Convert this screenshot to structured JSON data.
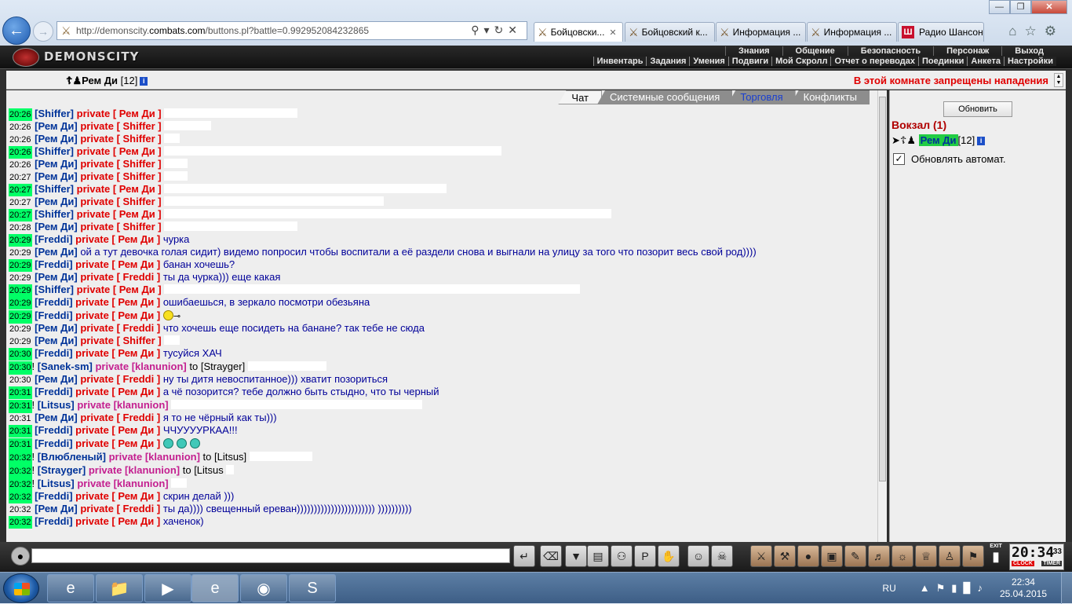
{
  "browser": {
    "url_prefix": "http://demonscity.",
    "url_domain": "combats.com",
    "url_path": "/buttons.pl?battle=0.992952084232865",
    "tabs": [
      {
        "label": "Бойцовски...",
        "active": true
      },
      {
        "label": "Бойцовский к..."
      },
      {
        "label": "Информация ..."
      },
      {
        "label": "Информация ..."
      },
      {
        "label": "Радио Шансон"
      }
    ]
  },
  "game": {
    "logo": "DEMONSCITY",
    "menu_top": [
      "Знания",
      "Общение",
      "Безопасность",
      "Персонаж",
      "Выход"
    ],
    "menu_sub": [
      "Инвентарь",
      "Задания",
      "Умения",
      "Подвиги",
      "Мой Скролл",
      "Отчет о переводах",
      "Поединки",
      "Анкета",
      "Настройки"
    ]
  },
  "room": {
    "user": "Рем Ди",
    "level": "[12]",
    "warning": "В этой комнате запрещены нападения"
  },
  "chat_tabs": [
    "Чат",
    "Системные сообщения",
    "Торговля",
    "Конфликты"
  ],
  "chat": [
    {
      "ts": "20:26",
      "hl": true,
      "nick": "[Shiffer]",
      "priv": "private [ Рем Ди ]",
      "msg": "",
      "redact": 170
    },
    {
      "ts": "20:26",
      "hl": false,
      "nick": "[Рем Ди]",
      "priv": "private [ Shiffer ]",
      "msg": "",
      "redact": 60
    },
    {
      "ts": "20:26",
      "hl": false,
      "nick": "[Рем Ди]",
      "priv": "private [ Shiffer ]",
      "msg": "",
      "redact": 20
    },
    {
      "ts": "20:26",
      "hl": true,
      "nick": "[Shiffer]",
      "priv": "private [ Рем Ди ]",
      "msg": "",
      "redact": 430
    },
    {
      "ts": "20:26",
      "hl": false,
      "nick": "[Рем Ди]",
      "priv": "private [ Shiffer ]",
      "msg": "",
      "redact": 30
    },
    {
      "ts": "20:27",
      "hl": false,
      "nick": "[Рем Ди]",
      "priv": "private [ Shiffer ]",
      "msg": "",
      "redact": 30
    },
    {
      "ts": "20:27",
      "hl": true,
      "nick": "[Shiffer]",
      "priv": "private [ Рем Ди ]",
      "msg": "",
      "redact": 360
    },
    {
      "ts": "20:27",
      "hl": false,
      "nick": "[Рем Ди]",
      "priv": "private [ Shiffer ]",
      "msg": "",
      "redact": 280
    },
    {
      "ts": "20:27",
      "hl": true,
      "nick": "[Shiffer]",
      "priv": "private [ Рем Ди ]",
      "msg": "",
      "redact": 570
    },
    {
      "ts": "20:28",
      "hl": false,
      "nick": "[Рем Ди]",
      "priv": "private [ Shiffer ]",
      "msg": "",
      "redact": 170
    },
    {
      "ts": "20:29",
      "hl": true,
      "nick": "[Freddi]",
      "priv": "private [ Рем Ди ]",
      "msg": "чурка",
      "redact": 0
    },
    {
      "ts": "20:29",
      "hl": false,
      "nick": "[Рем Ди]",
      "priv": "",
      "msg": "ой а тут девочка голая сидит) видемо попросил чтобы воспитали а её раздели снова и выгнали на улицу за того что позорит весь свой род))))",
      "redact": 0
    },
    {
      "ts": "20:29",
      "hl": true,
      "nick": "[Freddi]",
      "priv": "private [ Рем Ди ]",
      "msg": "банан хочешь?",
      "redact": 0
    },
    {
      "ts": "20:29",
      "hl": false,
      "nick": "[Рем Ди]",
      "priv": "private [ Freddi ]",
      "msg": "ты да чурка))) еще какая",
      "redact": 0
    },
    {
      "ts": "20:29",
      "hl": true,
      "nick": "[Shiffer]",
      "priv": "private [ Рем Ди ]",
      "msg": "",
      "redact": 530
    },
    {
      "ts": "20:29",
      "hl": true,
      "nick": "[Freddi]",
      "priv": "private [ Рем Ди ]",
      "msg": "ошибаешься, в зеркало посмотри обезьяна",
      "redact": 0
    },
    {
      "ts": "20:29",
      "hl": true,
      "nick": "[Freddi]",
      "priv": "private [ Рем Ди ]",
      "msg": "",
      "redact": 0,
      "smileys": 1
    },
    {
      "ts": "20:29",
      "hl": false,
      "nick": "[Рем Ди]",
      "priv": "private [ Freddi ]",
      "msg": "что хочешь еще посидеть на банане? так тебе не сюда",
      "redact": 0
    },
    {
      "ts": "20:29",
      "hl": false,
      "nick": "[Рем Ди]",
      "priv": "private [ Shiffer ]",
      "msg": "",
      "redact": 20
    },
    {
      "ts": "20:30",
      "hl": true,
      "nick": "[Freddi]",
      "priv": "private [ Рем Ди ]",
      "msg": "тусуйся ХАЧ",
      "redact": 0
    },
    {
      "ts": "20:30",
      "hl": true,
      "bang": true,
      "nick": "[Sanek-sm]",
      "priv": "private [klanunion]",
      "clan": true,
      "to": "to [Strayger]",
      "msg": "",
      "redact": 100
    },
    {
      "ts": "20:30",
      "hl": false,
      "nick": "[Рем Ди]",
      "priv": "private [ Freddi ]",
      "msg": "ну ты дитя невоспитанное))) хватит позориться",
      "redact": 0
    },
    {
      "ts": "20:31",
      "hl": true,
      "nick": "[Freddi]",
      "priv": "private [ Рем Ди ]",
      "msg": "а чё позорится? тебе должно быть стыдно, что ты черный",
      "redact": 0
    },
    {
      "ts": "20:31",
      "hl": true,
      "bang": true,
      "nick": "[Litsus]",
      "priv": "private [klanunion]",
      "clan": true,
      "msg": "",
      "redact": 320
    },
    {
      "ts": "20:31",
      "hl": false,
      "nick": "[Рем Ди]",
      "priv": "private [ Freddi ]",
      "msg": "я то не чёрный как ты)))",
      "redact": 0
    },
    {
      "ts": "20:31",
      "hl": true,
      "nick": "[Freddi]",
      "priv": "private [ Рем Ди ]",
      "msg": "ЧЧУУУУРКАА!!!",
      "redact": 0
    },
    {
      "ts": "20:31",
      "hl": true,
      "nick": "[Freddi]",
      "priv": "private [ Рем Ди ]",
      "msg": "",
      "redact": 0,
      "smileys": 3,
      "blue": true
    },
    {
      "ts": "20:32",
      "hl": true,
      "bang": true,
      "nick": "[Влюбленый]",
      "priv": "private [klanunion]",
      "clan": true,
      "to": "to [Litsus]",
      "msg": "",
      "redact": 80
    },
    {
      "ts": "20:32",
      "hl": true,
      "bang": true,
      "nick": "[Strayger]",
      "priv": "private [klanunion]",
      "clan": true,
      "to": "to [Litsus",
      "msg": "",
      "redact": 10
    },
    {
      "ts": "20:32",
      "hl": true,
      "bang": true,
      "nick": "[Litsus]",
      "priv": "private [klanunion]",
      "clan": true,
      "msg": "",
      "redact": 20
    },
    {
      "ts": "20:32",
      "hl": true,
      "nick": "[Freddi]",
      "priv": "private [ Рем Ди ]",
      "msg": "скрин делай )))",
      "redact": 0
    },
    {
      "ts": "20:32",
      "hl": false,
      "nick": "[Рем Ди]",
      "priv": "private [ Freddi ]",
      "msg": "ты да)))) свещенный ереван))))))))))))))))))))))) ))))))))))",
      "redact": 0
    },
    {
      "ts": "20:32",
      "hl": true,
      "nick": "[Freddi]",
      "priv": "private [ Рем Ди ]",
      "msg": "хаченок)",
      "redact": 0
    }
  ],
  "side": {
    "refresh_label": "Обновить",
    "room_name": "Вокзал (1)",
    "member_name": "Рем Ди",
    "member_level": "[12]",
    "auto_refresh_label": "Обновлять автомат.",
    "auto_refresh_checked": true
  },
  "clock": {
    "time": "20:34",
    "sec": "33",
    "left_label": "CLOCK",
    "right_label": "TIMER"
  },
  "exit_label": "EXIT",
  "taskbar": {
    "lang": "RU",
    "time": "22:34",
    "date": "25.04.2015"
  }
}
